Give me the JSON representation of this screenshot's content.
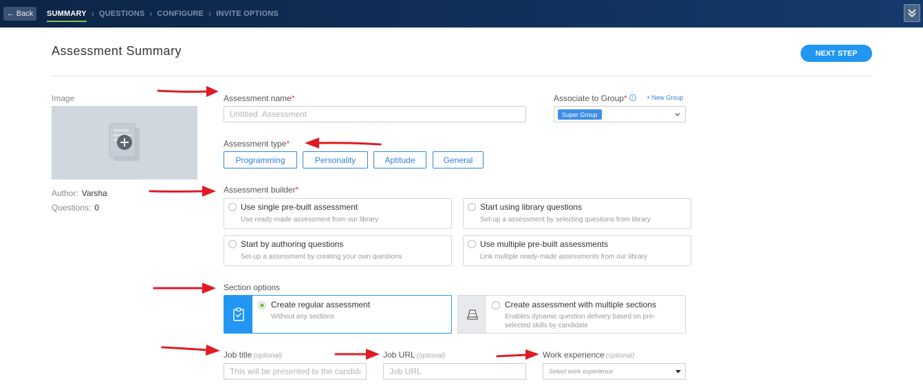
{
  "nav": {
    "back_label": "Back",
    "steps": [
      "SUMMARY",
      "QUESTIONS",
      "CONFIGURE",
      "INVITE OPTIONS"
    ],
    "active_step": "SUMMARY"
  },
  "header": {
    "title": "Assessment Summary",
    "next_step_label": "NEXT STEP"
  },
  "sidebar": {
    "image_label": "Image",
    "author_label": "Author:",
    "author_value": "Varsha",
    "questions_label": "Questions:",
    "questions_value": "0"
  },
  "form": {
    "name": {
      "label": "Assessment name",
      "required_mark": "*",
      "placeholder": "Untitled  Assessment"
    },
    "group": {
      "label": "Associate to Group",
      "required_mark": "*",
      "info_icon": "i",
      "new_group_label": "+ New Group",
      "selected": "Super Group"
    },
    "type": {
      "label": "Assessment type",
      "required_mark": "*",
      "options": [
        "Programming",
        "Personality",
        "Aptitude",
        "General"
      ]
    },
    "builder": {
      "label": "Assessment builder",
      "required_mark": "*",
      "options": [
        {
          "title": "Use single pre-built assessment",
          "desc": "Use ready-made assessment from our library"
        },
        {
          "title": "Start using library questions",
          "desc": "Set-up a assessment by selecting questions from library"
        },
        {
          "title": "Start by authoring questions",
          "desc": "Set-up a assessment by creating your own questions"
        },
        {
          "title": "Use multiple pre-built assessments",
          "desc": "Link multiple ready-made assessments from our library"
        }
      ]
    },
    "sections": {
      "label": "Section options",
      "options": [
        {
          "title": "Create regular assessment",
          "desc": "Without any sections",
          "selected": true
        },
        {
          "title": "Create assessment with multiple sections",
          "desc": "Enables dynamic question delivery based on pre-selected skills by candidate",
          "selected": false
        }
      ]
    },
    "job_title": {
      "label": "Job title",
      "optional": "(optional)",
      "placeholder": "This will be presented to the candidate"
    },
    "job_url": {
      "label": "Job URL",
      "optional": "(optional)",
      "placeholder": "Job URL"
    },
    "experience": {
      "label": "Work experience",
      "optional": "(optional)",
      "placeholder": "Select work experience"
    }
  },
  "colors": {
    "nav_bg": "#10305a",
    "accent": "#2196f3",
    "active_underline": "#8bc34a",
    "annotation_arrow": "#e01b24",
    "radio_selected": "#7cc141"
  },
  "icons": {
    "back": "left-arrow-icon",
    "collapse": "double-chevron-down-icon",
    "image_placeholder": "add-document-icon",
    "section_regular": "clipboard-check-icon",
    "section_multi": "stack-icon"
  }
}
